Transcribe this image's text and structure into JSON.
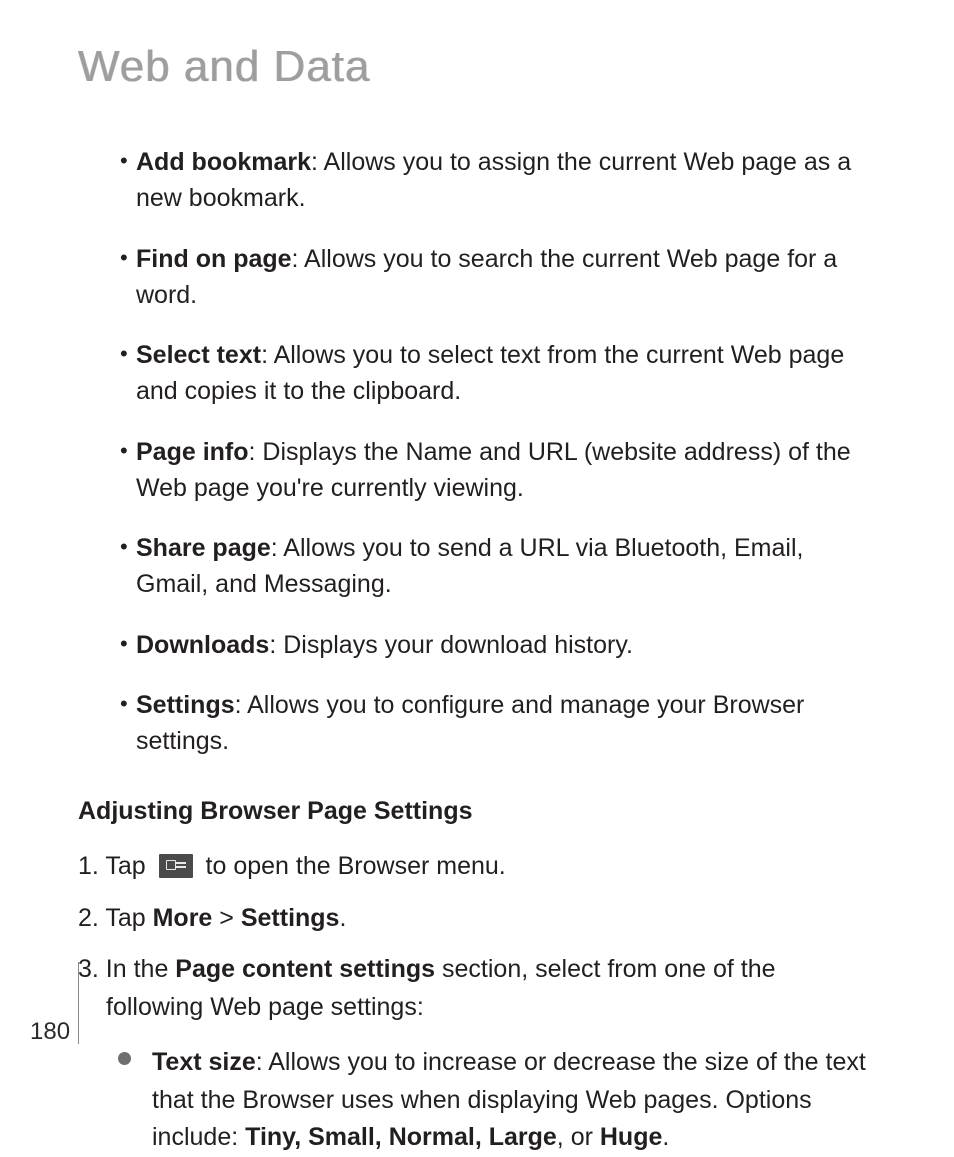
{
  "title": "Web and Data",
  "bullets": {
    "b0": {
      "term": "Add bookmark",
      "desc": ": Allows you to assign the current Web page as a new bookmark."
    },
    "b1": {
      "term": "Find on page",
      "desc": ": Allows you to search the current Web page for a word."
    },
    "b2": {
      "term": "Select text",
      "desc": ": Allows you to select text from the current Web page and copies it to the clipboard."
    },
    "b3": {
      "term": "Page info",
      "desc": ": Displays the Name and URL (website address) of the Web page you're currently viewing."
    },
    "b4": {
      "term": "Share page",
      "desc": ": Allows you to send a URL via Bluetooth, Email, Gmail, and Messaging."
    },
    "b5": {
      "term": "Downloads",
      "desc": ": Displays your download history."
    },
    "b6": {
      "term": "Settings",
      "desc": ": Allows you to configure and manage your Browser settings."
    }
  },
  "section_heading": "Adjusting Browser Page Settings",
  "steps": {
    "s1_pre": "1. Tap ",
    "s1_post": " to open the Browser menu.",
    "s2_pre": "2. Tap ",
    "s2_more": "More",
    "s2_sep": " > ",
    "s2_settings": "Settings",
    "s2_post": ".",
    "s3_pre": "3. In the ",
    "s3_bold": "Page content settings",
    "s3_post": " section, select from one of the following Web page settings:"
  },
  "sub": {
    "term": "Text size",
    "desc_pre": ": Allows you to increase or decrease the size of the text that the Browser uses when displaying Web pages. Options include: ",
    "opts1": "Tiny, Small, Normal, Large",
    "desc_mid": ", or ",
    "opts2": "Huge",
    "desc_post": "."
  },
  "page_number": "180"
}
